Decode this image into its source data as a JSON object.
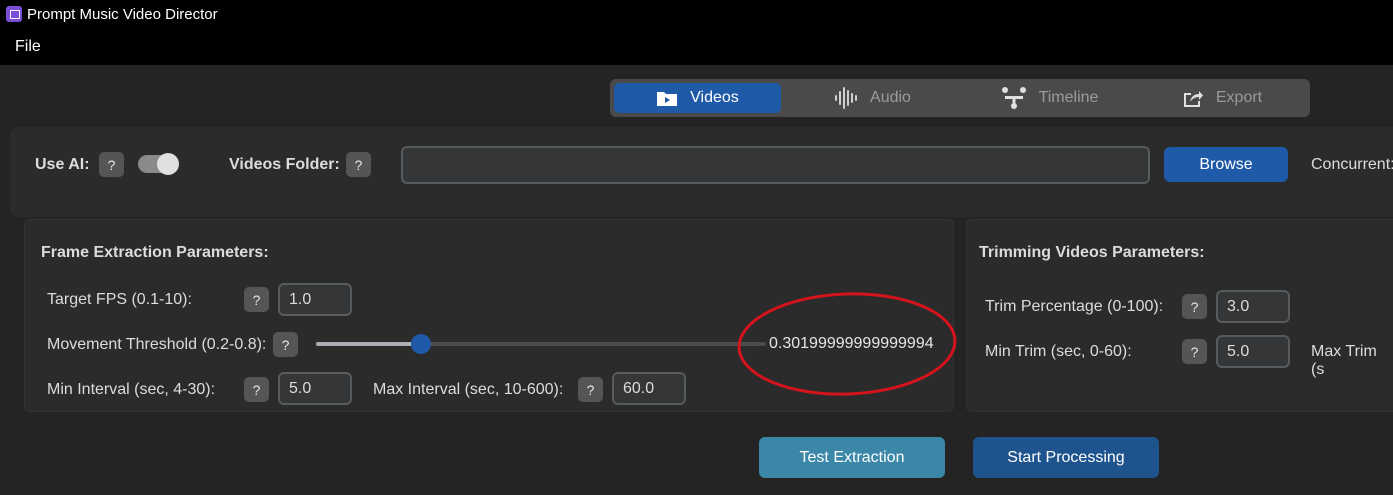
{
  "window": {
    "title": "Prompt Music Video Director"
  },
  "menu": {
    "file": "File"
  },
  "tabs": [
    {
      "label": "Videos",
      "icon": "video-folder-icon",
      "active": true
    },
    {
      "label": "Audio",
      "icon": "audio-waveform-icon",
      "active": false
    },
    {
      "label": "Timeline",
      "icon": "timeline-icon",
      "active": false
    },
    {
      "label": "Export",
      "icon": "export-icon",
      "active": false
    }
  ],
  "top": {
    "use_ai_label": "Use AI:",
    "use_ai_enabled": true,
    "help": "?",
    "videos_folder_label": "Videos Folder:",
    "videos_folder_value": "",
    "browse_label": "Browse",
    "concurrent_label": "Concurrent:"
  },
  "frame": {
    "title": "Frame Extraction Parameters:",
    "target_fps_label": "Target FPS (0.1-10):",
    "target_fps_value": "1.0",
    "movement_label": "Movement Threshold (0.2-0.8):",
    "movement_value": "0.30199999999999994",
    "movement_min": 0.2,
    "movement_max": 0.8,
    "min_interval_label": "Min Interval (sec, 4-30):",
    "min_interval_value": "5.0",
    "max_interval_label": "Max Interval (sec, 10-600):",
    "max_interval_value": "60.0"
  },
  "trim": {
    "title": "Trimming Videos Parameters:",
    "percentage_label": "Trim Percentage (0-100):",
    "percentage_value": "3.0",
    "min_trim_label": "Min Trim (sec, 0-60):",
    "min_trim_value": "5.0",
    "max_trim_label": "Max Trim (s"
  },
  "actions": {
    "test_label": "Test Extraction",
    "start_label": "Start Processing"
  },
  "colors": {
    "accent": "#1f5aa8",
    "test_button": "#3a87a8",
    "annotation": "#d4141c"
  }
}
